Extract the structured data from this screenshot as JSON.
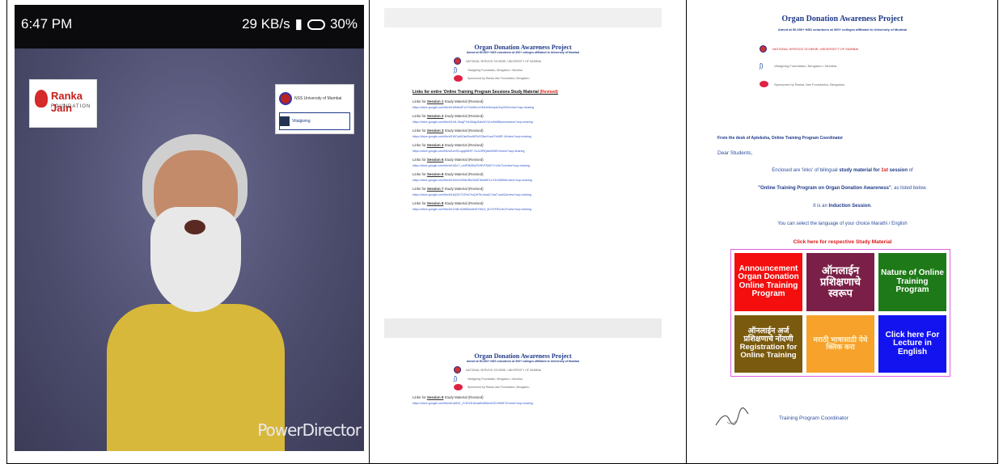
{
  "phone": {
    "status_time": "6:47 PM",
    "status_right": "29 KB/s",
    "battery": "30%",
    "logo_left_name": "Ranka Jain",
    "logo_left_sub": "FOUNDATION",
    "logo_right_top": "NSS University of Mumbai",
    "logo_right_bottom": "Vitalgiving",
    "watermark": "PowerDirector"
  },
  "doc_a": {
    "title": "Organ Donation Awareness Project",
    "subtitle": "Aimed at 50,000+ NSS volunteers at 300+ colleges affiliated to University of Mumbai",
    "rows": [
      "NATIONAL SERVICE SCHEME, UNIVERSITY OF MUMBAI",
      "Vitalgiving Foundation, Bengaluru / Mumbai",
      "Sponsored by Ranka Jain Foundation, Bengaluru"
    ],
    "links_title": "Links for entire 'Online Training Program Sessions Study Material",
    "links_rev": "(Revised)",
    "sessions": [
      {
        "prefix": "Links for ",
        "name": "Session 1",
        "suffix": " Study Material (Revised)",
        "url": "https://drive.google.com/file/d/1Wb8sdF1zTXeMbLcG9dUbSeeq4n3xpX02h/view?usp=sharing"
      },
      {
        "prefix": "Links for ",
        "name": "Session 2",
        "suffix": " Study Material (Revised)",
        "url": "https://drive.google.com/file/d/1eN-J8xgFYoUMag-BzkA4Yk1m9rkB0pwmu/view?usp=sharing"
      },
      {
        "prefix": "Links for ",
        "name": "Session 3",
        "suffix": " Study Material (Revised)",
        "url": "https://drive.google.com/file/d/1WCwNOsbDsoWRUt7BaxYszzf7vW8F-4k/view?usp=sharing"
      },
      {
        "prefix": "Links for ",
        "name": "Session 4",
        "suffix": " Study Material (Revised)",
        "url": "https://drive.google.com/file/d/1xnSCugqM5HP-YuJL5PtQskNNHEm/view?usp=sharing"
      },
      {
        "prefix": "Links for ",
        "name": "Session 5",
        "suffix": " Study Material (Revised)",
        "url": "https://drive.google.com/file/d/1bDcT_uAtF5MlDuRGRVFI0AF1YxSeTxo/view?usp=sharing"
      },
      {
        "prefix": "Links for ",
        "name": "Session 6",
        "suffix": " Study Material (Revised)",
        "url": "https://drive.google.com/file/d/1MmVVDfdURkGkMTWeb8Fz1-EbrJ56f0b1/view?usp=sharing"
      },
      {
        "prefix": "Links for ",
        "name": "Session 7",
        "suffix": " Study Material (Revised)",
        "url": "https://drive.google.com/file/d/1kQ2fJ7V2Hs7huQH7kUdoaCCdaT-swAZa/view?usp=sharing"
      },
      {
        "prefix": "Links for ",
        "name": "Session 8",
        "suffix": " Study Material (Revised)",
        "url": "https://drive.google.com/file/d/1CNB-N3dB5vw6vEY9h0J_dUYXFRoVbl-F/view?usp=sharing"
      }
    ]
  },
  "doc_b": {
    "session_prefix": "Links for ",
    "session_name": "Session 9",
    "session_suffix": " Study Material (Revised)",
    "url": "https://drive.google.com/file/d/1dtrDG_3YDO9I1bna8NdDibn0GDVWMF1K/view?usp=sharing"
  },
  "doc_c": {
    "desk": "From the desk of Apteksha, Online Training Program Coordinator",
    "dear": "Dear Students,",
    "p1_a": "Enclosed are 'links' of bilingual ",
    "p1_b": "study material for ",
    "p1_c": "1st",
    "p1_d": " session",
    "p1_e": " of",
    "p2_a": "\"Online Training Program on Organ Donation Awareness\"",
    "p2_b": ", as listed below.",
    "p3_a": "It is an ",
    "p3_b": "Induction Session",
    "p3_c": ".",
    "p4": "You can select the language of your choice Marathi / English",
    "click_here": "Click here for respective Study Material",
    "tiles": [
      "Announcement Organ Donation Online Training Program",
      "ऑनलाईन प्रशिक्षणाचे स्वरूप",
      "Nature of Online Training Program",
      "ऑनलाईन अर्ज प्रशिक्षणाचे नोंदणी Registration for Online Training",
      "मराठी भाषासाठी येथे क्लिक करा",
      "Click here For Lecture in English"
    ],
    "coordinator": "Training Program Coordinator"
  },
  "colors": {
    "header_blue": "#1f3a8a",
    "link_blue": "#2f55c8",
    "alert_red": "#e01717"
  }
}
